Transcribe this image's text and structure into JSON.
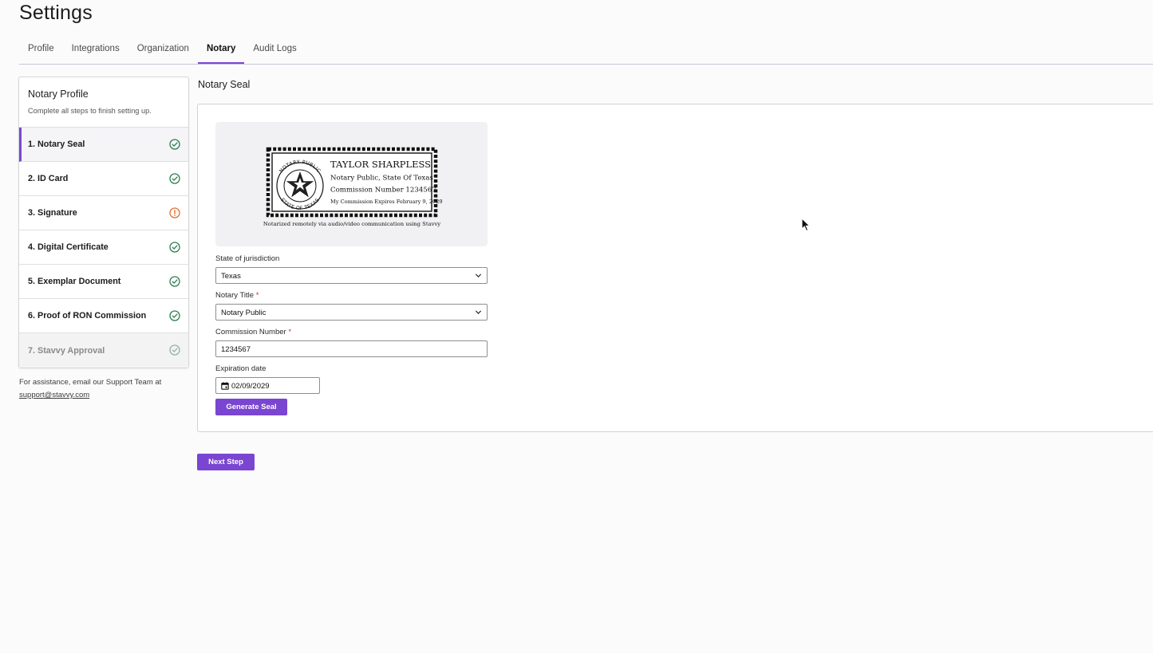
{
  "page": {
    "title": "Settings"
  },
  "tabs": [
    {
      "label": "Profile",
      "active": false
    },
    {
      "label": "Integrations",
      "active": false
    },
    {
      "label": "Organization",
      "active": false
    },
    {
      "label": "Notary",
      "active": true
    },
    {
      "label": "Audit Logs",
      "active": false
    }
  ],
  "sidebar": {
    "title": "Notary Profile",
    "subtitle": "Complete all steps to finish setting up.",
    "steps": [
      {
        "label": "1. Notary Seal",
        "status": "complete",
        "icon": "check-circle-icon"
      },
      {
        "label": "2. ID Card",
        "status": "complete",
        "icon": "check-circle-icon"
      },
      {
        "label": "3. Signature",
        "status": "warning",
        "icon": "alert-circle-icon"
      },
      {
        "label": "4. Digital Certificate",
        "status": "complete",
        "icon": "check-circle-icon"
      },
      {
        "label": "5. Exemplar Document",
        "status": "complete",
        "icon": "check-circle-icon"
      },
      {
        "label": "6. Proof of RON Commission",
        "status": "complete",
        "icon": "check-circle-icon"
      },
      {
        "label": "7. Stavvy Approval",
        "status": "disabled",
        "icon": "check-circle-icon"
      }
    ],
    "assist_text": "For assistance, email our Support Team at",
    "assist_email": "support@stavvy.com"
  },
  "main": {
    "section_title": "Notary Seal",
    "seal": {
      "ring_top": "NOTARY PUBLIC",
      "ring_bottom": "STATE OF TEXAS",
      "name": "TAYLOR SHARPLESS",
      "line1": "Notary Public, State Of Texas",
      "line2": "Commission Number 1234567",
      "line3": "My Commission Expires February 9, 2029",
      "caption": "Notarized remotely via audio/video communication using Stavvy"
    },
    "form": {
      "state_label": "State of jurisdiction",
      "state_value": "Texas",
      "title_label": "Notary Title",
      "title_value": "Notary Public",
      "commission_label": "Commission Number",
      "commission_value": "1234567",
      "expiration_label": "Expiration date",
      "expiration_value": "02/09/2029",
      "required_marker": "*",
      "generate_button": "Generate Seal"
    },
    "next_button": "Next Step"
  },
  "colors": {
    "accent": "#7a45d1",
    "success": "#2e7d4f",
    "warning": "#e0712c",
    "disabled": "#8fb59c"
  }
}
